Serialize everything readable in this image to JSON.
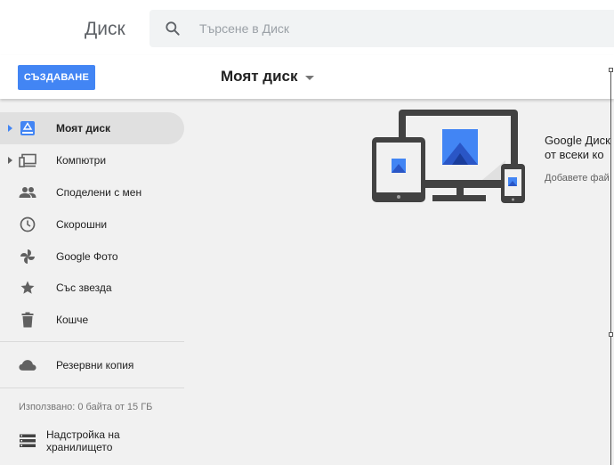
{
  "header": {
    "app_title": "Диск",
    "search_placeholder": "Търсене в Диск",
    "search_value": ""
  },
  "toolbar": {
    "new_button_label": "СЪЗДАВАНЕ",
    "breadcrumb_label": "Моят диск"
  },
  "sidebar": {
    "items": [
      {
        "label": "Моят диск",
        "icon": "my-drive-icon",
        "active": true,
        "expandable": true
      },
      {
        "label": "Компютри",
        "icon": "computers-icon",
        "active": false,
        "expandable": true
      },
      {
        "label": "Споделени с мен",
        "icon": "shared-people-icon",
        "active": false,
        "expandable": false
      },
      {
        "label": "Скорошни",
        "icon": "clock-icon",
        "active": false,
        "expandable": false
      },
      {
        "label": "Google Фото",
        "icon": "pinwheel-icon",
        "active": false,
        "expandable": false
      },
      {
        "label": "Със звезда",
        "icon": "star-icon",
        "active": false,
        "expandable": false
      },
      {
        "label": "Кошче",
        "icon": "trash-icon",
        "active": false,
        "expandable": false
      }
    ],
    "backups_label": "Резервни копия",
    "storage_text": "Използвано: 0 байта от 15 ГБ",
    "upgrade_label": "Надстройка на хранилището"
  },
  "promo": {
    "title_line1": "Google Диск",
    "title_line2": "от всеки ко",
    "description": "Добавете фай"
  },
  "colors": {
    "accent": "#4285f4",
    "device_gray": "#424242",
    "active_bg": "#e0e0e0"
  }
}
